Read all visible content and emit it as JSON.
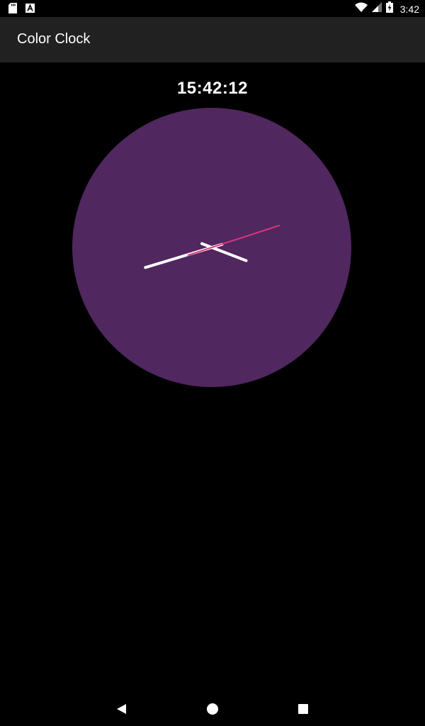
{
  "status_bar": {
    "time": "3:42",
    "icons": [
      "sd-card-icon",
      "a-notification-icon",
      "wifi-icon",
      "signal-icon",
      "battery-charging-icon"
    ]
  },
  "app_bar": {
    "title": "Color Clock"
  },
  "clock": {
    "digital_time": "15:42:12",
    "face_color": "#50275f",
    "hand_color": "#ffffff",
    "second_hand_color": "#e0357a",
    "hours": 15,
    "minutes": 42,
    "seconds": 12
  },
  "nav_bar": {
    "icons": [
      "back-icon",
      "home-icon",
      "recents-icon"
    ]
  }
}
